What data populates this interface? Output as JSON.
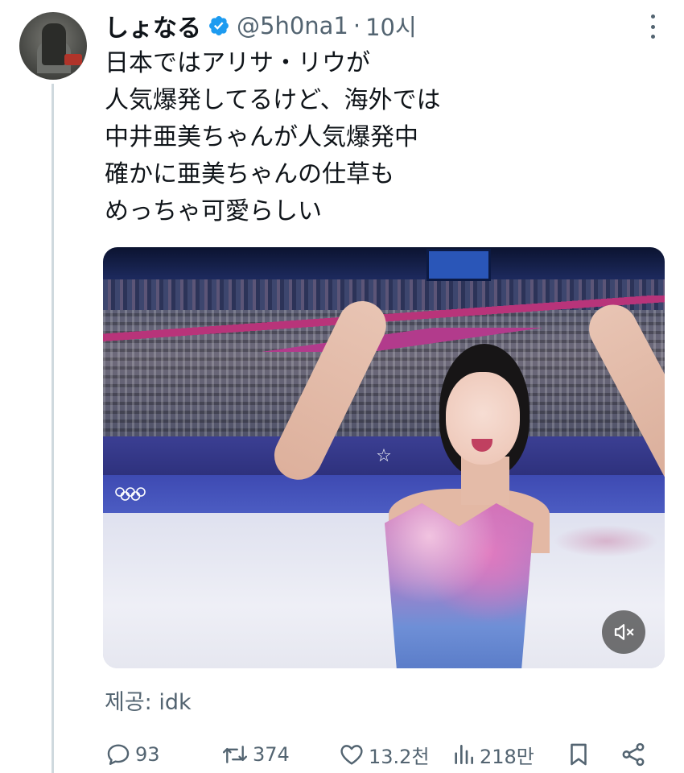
{
  "tweet": {
    "display_name": "しょなる",
    "handle": "@5h0na1",
    "separator": "·",
    "time": "10시",
    "text_lines": [
      "日本ではアリサ・リウが",
      "人気爆発してるけど、海外では",
      "中井亜美ちゃんが人気爆発中",
      "確かに亜美ちゃんの仕草も",
      "めっちゃ可愛らしい"
    ],
    "source": "제공: idk"
  },
  "actions": {
    "replies": "93",
    "reposts": "374",
    "likes": "13.2천",
    "views": "218만"
  },
  "colors": {
    "text": "#0f1419",
    "secondary": "#536471",
    "verified": "#1d9bf0",
    "thread_line": "#cfd9de"
  },
  "icons": [
    "verified-badge-icon",
    "more-options-icon",
    "mute-icon",
    "reply-icon",
    "repost-icon",
    "like-icon",
    "views-icon",
    "bookmark-icon",
    "share-icon"
  ]
}
